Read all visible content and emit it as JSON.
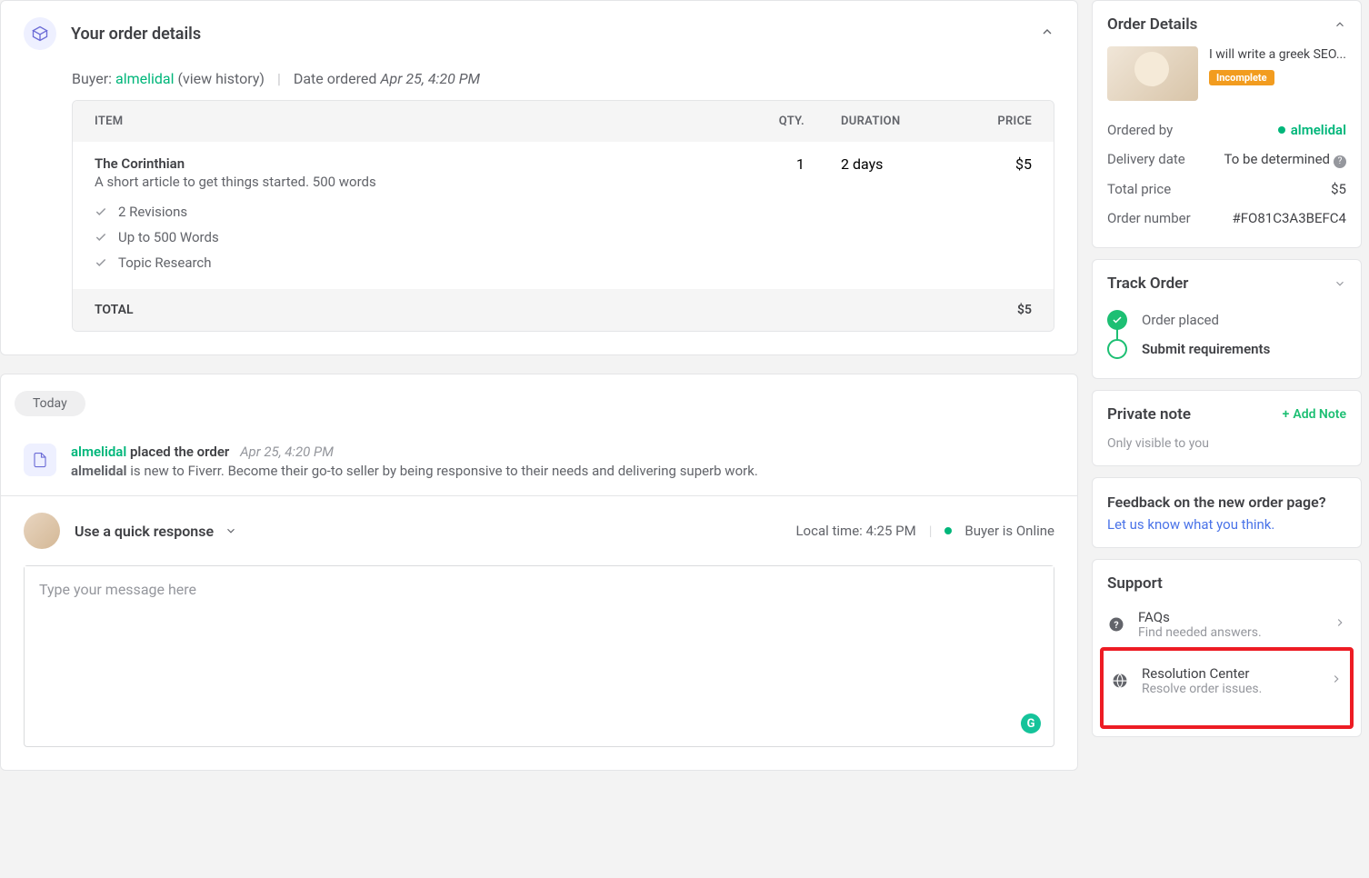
{
  "order": {
    "title": "Your order details",
    "buyer_label": "Buyer:",
    "buyer": "almelidal",
    "view_history": "(view history)",
    "date_label": "Date ordered",
    "date_value": "Apr 25, 4:20 PM",
    "cols": {
      "item": "ITEM",
      "qty": "QTY.",
      "duration": "DURATION",
      "price": "PRICE"
    },
    "item": {
      "name": "The Corinthian",
      "desc": "A short article to get things started. 500 words",
      "qty": "1",
      "duration": "2 days",
      "price": "$5",
      "features": [
        "2 Revisions",
        "Up to 500 Words",
        "Topic Research"
      ]
    },
    "total_label": "TOTAL",
    "total_value": "$5"
  },
  "activity": {
    "today": "Today",
    "buyer": "almelidal",
    "placed": "placed the order",
    "ts": "Apr 25, 4:20 PM",
    "tip_prefix": "almelidal",
    "tip_rest": " is new to Fiverr. Become their go-to seller by being responsive to their needs and delivering superb work."
  },
  "response": {
    "quick": "Use a quick response",
    "local_time": "Local time: 4:25 PM",
    "online": "Buyer is Online",
    "placeholder": "Type your message here"
  },
  "details": {
    "heading": "Order Details",
    "gig_title": "I will write a greek SEO...",
    "badge": "Incomplete",
    "ordered_by_label": "Ordered by",
    "ordered_by_value": "almelidal",
    "delivery_label": "Delivery date",
    "delivery_value": "To be determined",
    "price_label": "Total price",
    "price_value": "$5",
    "number_label": "Order number",
    "number_value": "#FO81C3A3BEFC4"
  },
  "track": {
    "heading": "Track Order",
    "step1": "Order placed",
    "step2": "Submit requirements"
  },
  "note": {
    "heading": "Private note",
    "add": "Add Note",
    "sub": "Only visible to you"
  },
  "feedback": {
    "heading": "Feedback on the new order page?",
    "link": "Let us know what you think"
  },
  "support": {
    "heading": "Support",
    "faqs": {
      "title": "FAQs",
      "sub": "Find needed answers."
    },
    "resolution": {
      "title": "Resolution Center",
      "sub": "Resolve order issues."
    }
  }
}
